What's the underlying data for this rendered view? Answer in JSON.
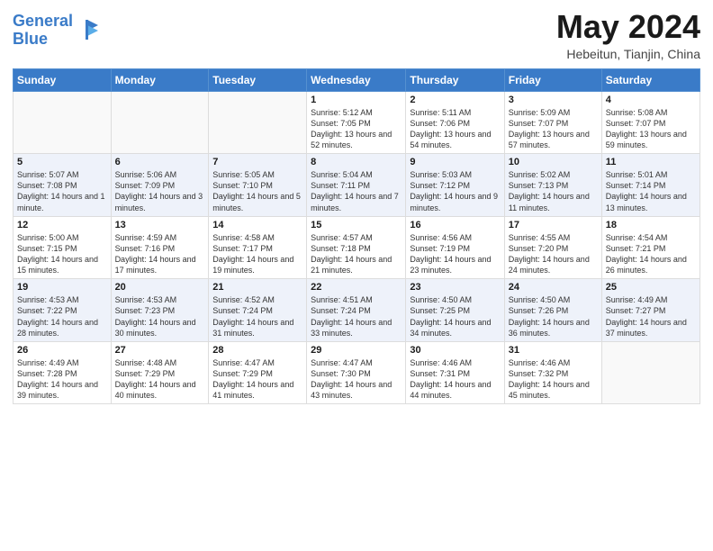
{
  "header": {
    "logo_line1": "General",
    "logo_line2": "Blue",
    "month_title": "May 2024",
    "location": "Hebeitun, Tianjin, China"
  },
  "weekdays": [
    "Sunday",
    "Monday",
    "Tuesday",
    "Wednesday",
    "Thursday",
    "Friday",
    "Saturday"
  ],
  "weeks": [
    [
      {
        "day": "",
        "info": ""
      },
      {
        "day": "",
        "info": ""
      },
      {
        "day": "",
        "info": ""
      },
      {
        "day": "1",
        "info": "Sunrise: 5:12 AM\nSunset: 7:05 PM\nDaylight: 13 hours and 52 minutes."
      },
      {
        "day": "2",
        "info": "Sunrise: 5:11 AM\nSunset: 7:06 PM\nDaylight: 13 hours and 54 minutes."
      },
      {
        "day": "3",
        "info": "Sunrise: 5:09 AM\nSunset: 7:07 PM\nDaylight: 13 hours and 57 minutes."
      },
      {
        "day": "4",
        "info": "Sunrise: 5:08 AM\nSunset: 7:07 PM\nDaylight: 13 hours and 59 minutes."
      }
    ],
    [
      {
        "day": "5",
        "info": "Sunrise: 5:07 AM\nSunset: 7:08 PM\nDaylight: 14 hours and 1 minute."
      },
      {
        "day": "6",
        "info": "Sunrise: 5:06 AM\nSunset: 7:09 PM\nDaylight: 14 hours and 3 minutes."
      },
      {
        "day": "7",
        "info": "Sunrise: 5:05 AM\nSunset: 7:10 PM\nDaylight: 14 hours and 5 minutes."
      },
      {
        "day": "8",
        "info": "Sunrise: 5:04 AM\nSunset: 7:11 PM\nDaylight: 14 hours and 7 minutes."
      },
      {
        "day": "9",
        "info": "Sunrise: 5:03 AM\nSunset: 7:12 PM\nDaylight: 14 hours and 9 minutes."
      },
      {
        "day": "10",
        "info": "Sunrise: 5:02 AM\nSunset: 7:13 PM\nDaylight: 14 hours and 11 minutes."
      },
      {
        "day": "11",
        "info": "Sunrise: 5:01 AM\nSunset: 7:14 PM\nDaylight: 14 hours and 13 minutes."
      }
    ],
    [
      {
        "day": "12",
        "info": "Sunrise: 5:00 AM\nSunset: 7:15 PM\nDaylight: 14 hours and 15 minutes."
      },
      {
        "day": "13",
        "info": "Sunrise: 4:59 AM\nSunset: 7:16 PM\nDaylight: 14 hours and 17 minutes."
      },
      {
        "day": "14",
        "info": "Sunrise: 4:58 AM\nSunset: 7:17 PM\nDaylight: 14 hours and 19 minutes."
      },
      {
        "day": "15",
        "info": "Sunrise: 4:57 AM\nSunset: 7:18 PM\nDaylight: 14 hours and 21 minutes."
      },
      {
        "day": "16",
        "info": "Sunrise: 4:56 AM\nSunset: 7:19 PM\nDaylight: 14 hours and 23 minutes."
      },
      {
        "day": "17",
        "info": "Sunrise: 4:55 AM\nSunset: 7:20 PM\nDaylight: 14 hours and 24 minutes."
      },
      {
        "day": "18",
        "info": "Sunrise: 4:54 AM\nSunset: 7:21 PM\nDaylight: 14 hours and 26 minutes."
      }
    ],
    [
      {
        "day": "19",
        "info": "Sunrise: 4:53 AM\nSunset: 7:22 PM\nDaylight: 14 hours and 28 minutes."
      },
      {
        "day": "20",
        "info": "Sunrise: 4:53 AM\nSunset: 7:23 PM\nDaylight: 14 hours and 30 minutes."
      },
      {
        "day": "21",
        "info": "Sunrise: 4:52 AM\nSunset: 7:24 PM\nDaylight: 14 hours and 31 minutes."
      },
      {
        "day": "22",
        "info": "Sunrise: 4:51 AM\nSunset: 7:24 PM\nDaylight: 14 hours and 33 minutes."
      },
      {
        "day": "23",
        "info": "Sunrise: 4:50 AM\nSunset: 7:25 PM\nDaylight: 14 hours and 34 minutes."
      },
      {
        "day": "24",
        "info": "Sunrise: 4:50 AM\nSunset: 7:26 PM\nDaylight: 14 hours and 36 minutes."
      },
      {
        "day": "25",
        "info": "Sunrise: 4:49 AM\nSunset: 7:27 PM\nDaylight: 14 hours and 37 minutes."
      }
    ],
    [
      {
        "day": "26",
        "info": "Sunrise: 4:49 AM\nSunset: 7:28 PM\nDaylight: 14 hours and 39 minutes."
      },
      {
        "day": "27",
        "info": "Sunrise: 4:48 AM\nSunset: 7:29 PM\nDaylight: 14 hours and 40 minutes."
      },
      {
        "day": "28",
        "info": "Sunrise: 4:47 AM\nSunset: 7:29 PM\nDaylight: 14 hours and 41 minutes."
      },
      {
        "day": "29",
        "info": "Sunrise: 4:47 AM\nSunset: 7:30 PM\nDaylight: 14 hours and 43 minutes."
      },
      {
        "day": "30",
        "info": "Sunrise: 4:46 AM\nSunset: 7:31 PM\nDaylight: 14 hours and 44 minutes."
      },
      {
        "day": "31",
        "info": "Sunrise: 4:46 AM\nSunset: 7:32 PM\nDaylight: 14 hours and 45 minutes."
      },
      {
        "day": "",
        "info": ""
      }
    ]
  ]
}
